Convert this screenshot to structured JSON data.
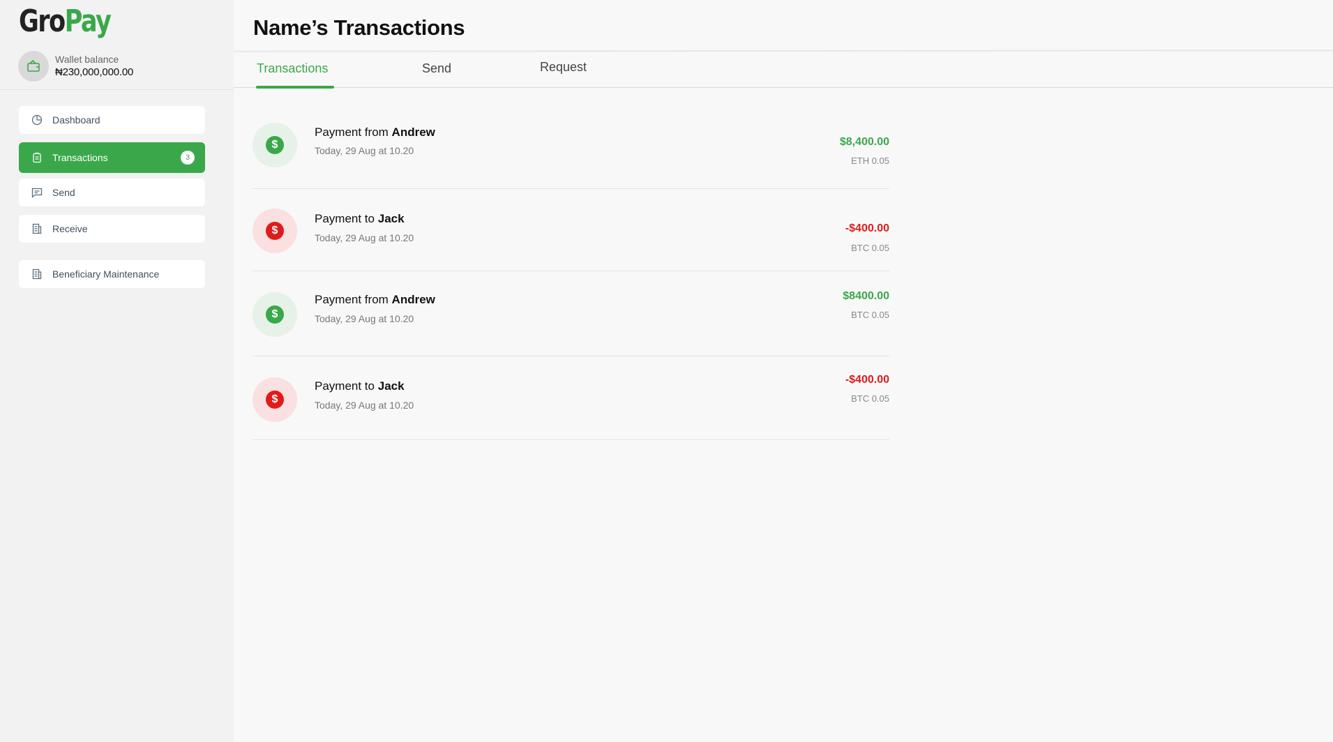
{
  "app": {
    "logo_part1": "Gro",
    "logo_part2": "Pay",
    "accent_color": "#3aa84a",
    "negative_color": "#e01b1b"
  },
  "wallet": {
    "label": "Wallet balance",
    "value": "₦230,000,000.00",
    "icon": "wallet-icon"
  },
  "sidebar": {
    "items": [
      {
        "label": "Dashboard",
        "icon": "pie-chart-icon",
        "active": false
      },
      {
        "label": "Transactions",
        "icon": "clipboard-icon",
        "active": true,
        "badge": "3"
      },
      {
        "label": "Send",
        "icon": "message-icon",
        "active": false
      },
      {
        "label": "Receive",
        "icon": "document-icon",
        "active": false
      },
      {
        "label": "Beneficiary Maintenance",
        "icon": "document-icon",
        "active": false
      }
    ]
  },
  "header": {
    "title": "Name’s Transactions"
  },
  "tabs": [
    {
      "label": "Transactions",
      "active": true
    },
    {
      "label": "Send",
      "active": false
    },
    {
      "label": "Request",
      "active": false
    }
  ],
  "transactions": [
    {
      "prefix": "Payment from",
      "party": "Andrew",
      "date": "Today, 29 Aug at 10.20",
      "amount": "$8,400.00",
      "crypto": "ETH 0.05",
      "direction": "in",
      "icon": "dollar-coin-icon"
    },
    {
      "prefix": "Payment to",
      "party": "Jack",
      "date": "Today, 29 Aug at 10.20",
      "amount": "-$400.00",
      "crypto": "BTC 0.05",
      "direction": "out",
      "icon": "dollar-coin-icon"
    },
    {
      "prefix": "Payment from",
      "party": "Andrew",
      "date": "Today, 29 Aug at 10.20",
      "amount": "$8400.00",
      "crypto": "BTC 0.05",
      "direction": "in",
      "icon": "dollar-coin-icon"
    },
    {
      "prefix": "Payment to",
      "party": "Jack",
      "date": "Today, 29 Aug at 10.20",
      "amount": "-$400.00",
      "crypto": "BTC 0.05",
      "direction": "out",
      "icon": "dollar-coin-icon"
    }
  ]
}
